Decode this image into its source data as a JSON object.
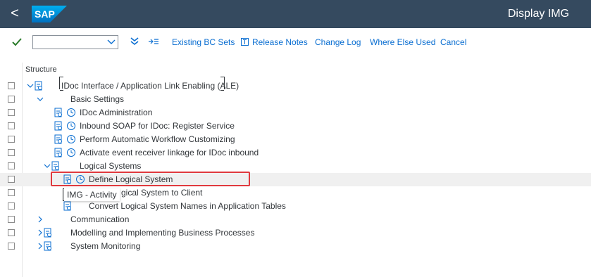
{
  "shell": {
    "back_label": "<",
    "logo_text": "SAP",
    "title": "Display IMG"
  },
  "toolbar": {
    "combo_value": "",
    "existing_bc_sets": "Existing BC Sets",
    "release_notes": "Release Notes",
    "change_log": "Change Log",
    "where_else_used": "Where Else Used",
    "cancel": "Cancel"
  },
  "tree": {
    "header": "Structure",
    "rows": [
      {
        "label": "IDoc Interface / Application Link Enabling (ALE)"
      },
      {
        "label": "Basic Settings"
      },
      {
        "label": "IDoc Administration"
      },
      {
        "label": "Inbound SOAP for IDoc: Register Service"
      },
      {
        "label": "Perform Automatic Workflow Customizing"
      },
      {
        "label": "Activate event receiver linkage for IDoc inbound"
      },
      {
        "label": "Logical Systems"
      },
      {
        "label": "Define Logical System"
      },
      {
        "label": "gical System to Client"
      },
      {
        "label": "Convert Logical System Names in Application Tables"
      },
      {
        "label": "Communication"
      },
      {
        "label": "Modelling and Implementing Business Processes"
      },
      {
        "label": "System Monitoring"
      }
    ],
    "tooltip": "IMG - Activity"
  },
  "colors": {
    "shell_bg": "#354a5f",
    "accent": "#0a6ed1",
    "highlight_border": "#e0393e",
    "icon_green": "#2b7c2b"
  }
}
